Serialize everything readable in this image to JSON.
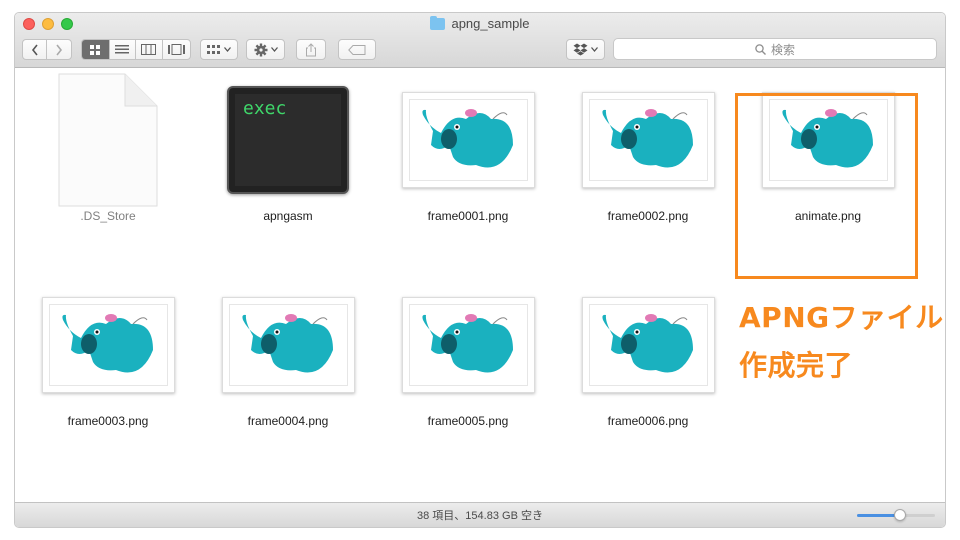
{
  "window": {
    "title": "apng_sample"
  },
  "toolbar": {
    "back_icon": "chevron-left-icon",
    "forward_icon": "chevron-right-icon",
    "search_placeholder": "検索",
    "view_mode": "icon"
  },
  "files": [
    {
      "name": ".DS_Store",
      "kind": "document",
      "dimmed": true
    },
    {
      "name": "apngasm",
      "kind": "exec",
      "exec_label": "exec"
    },
    {
      "name": "frame0001.png",
      "kind": "png"
    },
    {
      "name": "frame0002.png",
      "kind": "png"
    },
    {
      "name": "animate.png",
      "kind": "png",
      "highlighted": true
    },
    {
      "name": "frame0003.png",
      "kind": "png"
    },
    {
      "name": "frame0004.png",
      "kind": "png"
    },
    {
      "name": "frame0005.png",
      "kind": "png"
    },
    {
      "name": "frame0006.png",
      "kind": "png"
    }
  ],
  "annotation": {
    "line1": "APNGファイルの",
    "line2": "作成完了",
    "color": "#f7891e"
  },
  "statusbar": {
    "text": "38 項目、154.83 GB 空き",
    "zoom_level": 0.55
  },
  "colors": {
    "accent": "#4a90e2",
    "elephant": "#1ab1bf",
    "highlight": "#f7891e"
  }
}
